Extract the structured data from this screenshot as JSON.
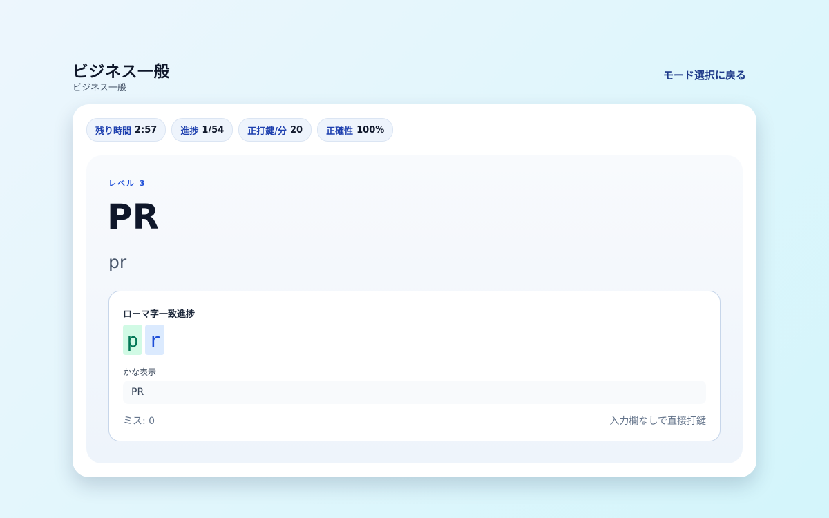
{
  "header": {
    "title": "ビジネス一般",
    "subtitle": "ビジネス一般",
    "back_link": "モード選択に戻る"
  },
  "stats": [
    {
      "label": "残り時間",
      "value": "2:57"
    },
    {
      "label": "進捗",
      "value": "1/54"
    },
    {
      "label": "正打鍵/分",
      "value": "20"
    },
    {
      "label": "正確性",
      "value": "100%"
    }
  ],
  "prompt": {
    "level": "レベル 3",
    "word": "PR",
    "reading": "pr"
  },
  "progress": {
    "title": "ローマ字一致進捗",
    "chars": [
      {
        "char": "p",
        "state": "typed"
      },
      {
        "char": "r",
        "state": "current"
      }
    ],
    "kana_label": "かな表示",
    "kana_value": "PR",
    "miss": "ミス: 0",
    "hint": "入力欄なしで直接打鍵"
  },
  "colors": {
    "accent": "#1e40af",
    "typed_bg": "#d1fae5",
    "typed_text": "#047857",
    "current_bg": "#dbeafe",
    "current_text": "#1d4ed8"
  }
}
